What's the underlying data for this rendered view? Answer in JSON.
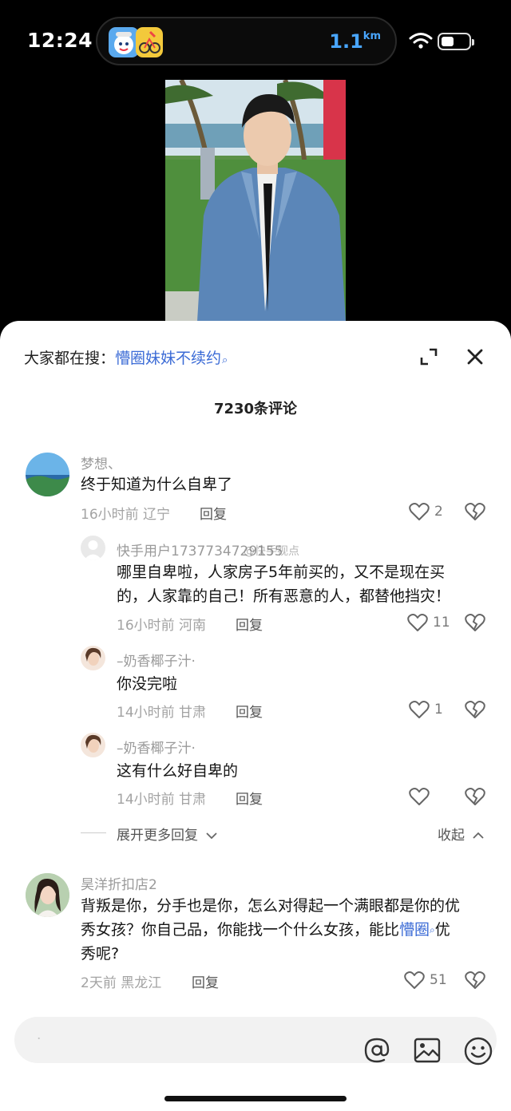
{
  "status": {
    "time": "12:24",
    "distance_value": "1.1",
    "distance_unit": "km",
    "colors": {
      "distance": "#49a6ff"
    }
  },
  "sheet": {
    "search_prefix": "大家都在搜：",
    "search_keyword": "懵圈妹妹不续约",
    "comment_count": "7230条评论",
    "colors": {
      "keyword": "#3b6bd6"
    }
  },
  "comments": [
    {
      "name": "梦想、",
      "text": "终于知道为什么自卑了",
      "time": "16小时前",
      "location": "辽宁",
      "reply_label": "回复",
      "likes": "2",
      "replies": [
        {
          "name": "快手用户1737734729155",
          "text_line1": "哪里自卑啦，人家房子5年前买的，又不是现在买",
          "text_line2": "的，人家靠的自己！所有恶意的人，都替他挡灾！",
          "time": "16小时前",
          "location": "河南",
          "reply_label": "回复",
          "likes": "11"
        },
        {
          "name": "–奶香椰子汁·",
          "text": "你没完啦",
          "time": "14小时前",
          "location": "甘肃",
          "reply_label": "回复",
          "likes": "1"
        },
        {
          "name": "–奶香椰子汁·",
          "text": "这有什么好自卑的",
          "time": "14小时前",
          "location": "甘肃",
          "reply_label": "回复",
          "likes": ""
        }
      ],
      "more_replies_label": "展开更多回复",
      "collapse_label": "收起"
    },
    {
      "name": "昊洋折扣店2",
      "text_line1": "背叛是你，分手也是你，怎么对得起一个满眼都是你的优",
      "text_line2a": "秀女孩？你自己品，你能找一个什么女孩，能比",
      "text_line2_keyword": "懵圈",
      "text_line2b": "优",
      "text_line3": "秀呢?",
      "time": "2天前",
      "location": "黑龙江",
      "reply_label": "回复",
      "likes": "51"
    }
  ],
  "watermark": "@快手视点",
  "input": {
    "placeholder": "·"
  },
  "icons": [
    "wifi-icon",
    "battery-icon",
    "search-small-icon",
    "expand-icon",
    "close-icon",
    "heart-icon",
    "broken-heart-icon",
    "chevron-down-icon",
    "chevron-up-icon",
    "at-icon",
    "image-icon",
    "emoji-icon"
  ]
}
